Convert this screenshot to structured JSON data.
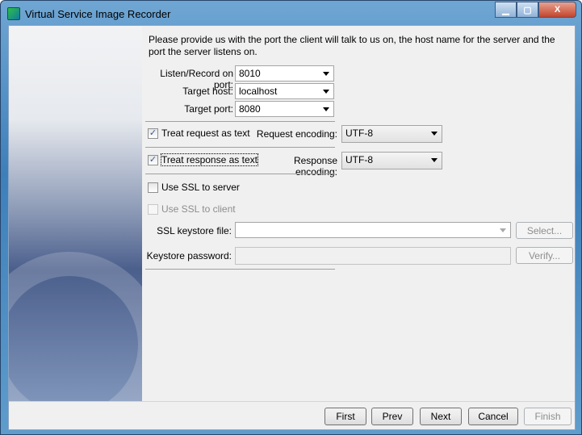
{
  "window": {
    "title": "Virtual Service Image Recorder",
    "minimize": "▁",
    "maximize": "▢",
    "close": "X"
  },
  "intro": "Please provide us with the port the client will talk to us on, the host name for the server and the port the server listens on.",
  "form": {
    "listen_label": "Listen/Record on port:",
    "listen_value": "8010",
    "host_label": "Target host:",
    "host_value": "localhost",
    "port_label": "Target port:",
    "port_value": "8080",
    "treat_request": {
      "label": "Treat request as text",
      "checked": true
    },
    "request_enc_label": "Request encoding:",
    "request_enc_value": "UTF-8",
    "treat_response": {
      "label": "Treat response as text",
      "checked": true
    },
    "response_enc_label": "Response encoding:",
    "response_enc_value": "UTF-8",
    "ssl_server": {
      "label": "Use SSL to server",
      "checked": false
    },
    "ssl_client": {
      "label": "Use SSL to client",
      "checked": false,
      "enabled": false
    },
    "keystore_label": "SSL keystore file:",
    "keystore_value": "",
    "select_label": "Select...",
    "password_label": "Keystore password:",
    "password_value": "",
    "verify_label": "Verify..."
  },
  "buttons": {
    "first": "First",
    "prev": "Prev",
    "next": "Next",
    "cancel": "Cancel",
    "finish": "Finish"
  },
  "check_glyph": "✓"
}
